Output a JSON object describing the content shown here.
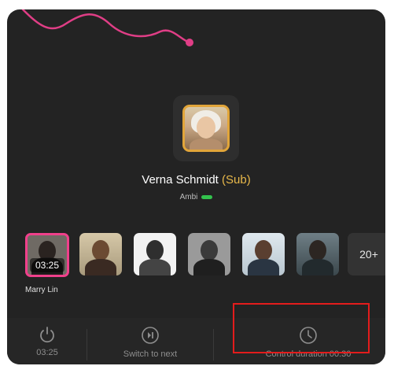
{
  "colors": {
    "panel_bg": "#232323",
    "accent_pink": "#f0408b",
    "sub_gold": "#e8b84a",
    "online_green": "#33c24d",
    "highlight_red": "#e31c1c"
  },
  "host": {
    "name": "Verna Schmidt",
    "role_tag": "(Sub)",
    "status_label": "Ambi"
  },
  "members": [
    {
      "name": "Marry Lin",
      "timer": "03:25",
      "active": true
    },
    {
      "name": "",
      "active": false
    },
    {
      "name": "",
      "active": false
    },
    {
      "name": "",
      "active": false
    },
    {
      "name": "",
      "active": false
    },
    {
      "name": "",
      "active": false
    }
  ],
  "more_count": "20+",
  "active_member_name": "Marry Lin",
  "bottom_actions": [
    {
      "icon": "power-icon",
      "label": "03:25"
    },
    {
      "icon": "play-pause-icon",
      "label": "Switch to next"
    },
    {
      "icon": "clock-icon",
      "label": "Control duration 00:30"
    }
  ]
}
